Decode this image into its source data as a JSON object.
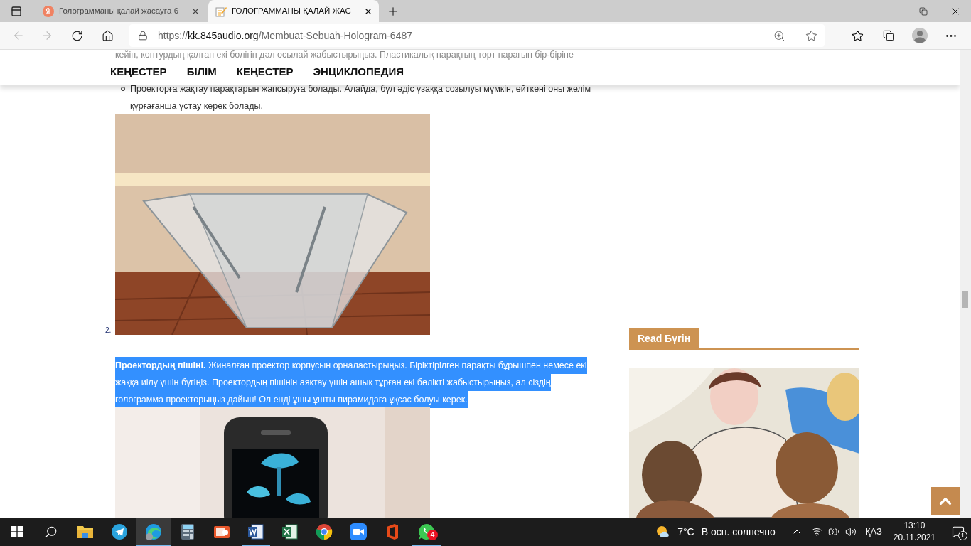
{
  "browser": {
    "tabs": [
      {
        "title": "Голограмманы қалай жасауға 6",
        "selected": false
      },
      {
        "title": "ГОЛОГРАММАНЫ ҚАЛАЙ ЖАС",
        "selected": true
      }
    ],
    "url": {
      "scheme": "https://",
      "host": "kk.845audio.org",
      "path": "/Membuat-Sebuah-Hologram-6487"
    }
  },
  "nav": [
    "КЕҢЕСТЕР",
    "БІЛІМ",
    "КЕҢЕСТЕР",
    "ЭНЦИКЛОПЕДИЯ"
  ],
  "article": {
    "faded_line": "кейін, контурдың қалған екі бөлігін дәл осылай жабыстырыңыз. Пластикалық парақтың төрт парағын бір-біріне",
    "bullets": [
      "Проекторға жақтау парақтарын жапсыруға болады. Алайда, бұл әдіс ұзаққа созылуы мүмкін, өйткені оны желім құрғағанша ұстау керек болады."
    ],
    "step_number": "2.",
    "step_text": "**Проектордың пішіні.** Жиналған проектор корпусын орналастырыңыз. Біріктірілген парақты бұрышпен немесе екі жаққа иілу үшін бүгіңіз. Проектордың пішінін аяқтау үшін ашық тұрған екі бөлікті жабыстырыңыз, ал сіздің голограмма проекторыңыз дайын! Ол енді ұшы ұшты пирамидаға ұқсас болуы керек.",
    "step_selected": true
  },
  "sidebar": {
    "heading": "Read Бүгін"
  },
  "taskbar": {
    "apps": [
      {
        "kind": "explorer",
        "active": false,
        "running": false
      },
      {
        "kind": "telegram",
        "active": false,
        "running": false
      },
      {
        "kind": "edge",
        "active": true,
        "running": true
      },
      {
        "kind": "calculator",
        "active": false,
        "running": false
      },
      {
        "kind": "powerpoint",
        "active": false,
        "running": false
      },
      {
        "kind": "word",
        "active": false,
        "running": true
      },
      {
        "kind": "excel",
        "active": false,
        "running": false
      },
      {
        "kind": "chrome",
        "active": false,
        "running": false
      },
      {
        "kind": "zoom",
        "active": false,
        "running": false
      },
      {
        "kind": "office",
        "active": false,
        "running": false
      },
      {
        "kind": "whatsapp",
        "active": false,
        "running": true,
        "badge": "4"
      }
    ],
    "weather": {
      "temperature": "7°C",
      "condition": "В осн. солнечно"
    },
    "language": "ҚАЗ",
    "time": "13:10",
    "date": "20.11.2021",
    "notifications": "1"
  }
}
